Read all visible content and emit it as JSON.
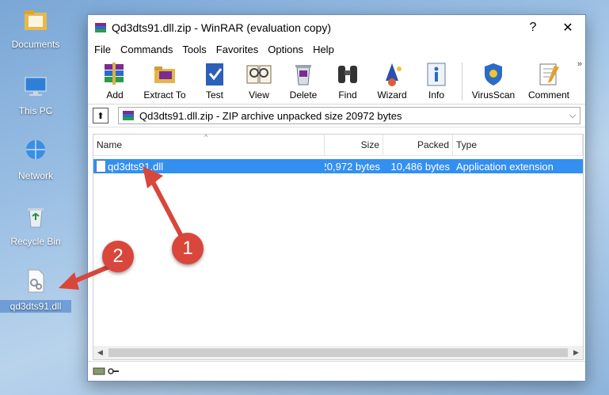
{
  "desktop": {
    "icons": [
      {
        "label": "Documents",
        "icon": "documents-folder-icon"
      },
      {
        "label": "This PC",
        "icon": "this-pc-icon"
      },
      {
        "label": "Network",
        "icon": "network-icon"
      },
      {
        "label": "Recycle Bin",
        "icon": "recycle-bin-icon"
      },
      {
        "label": "qd3dts91.dll",
        "icon": "dll-file-icon"
      }
    ]
  },
  "window": {
    "title": "Qd3dts91.dll.zip - WinRAR (evaluation copy)",
    "help_glyph": "?",
    "close_glyph": "✕",
    "menu": [
      "File",
      "Commands",
      "Tools",
      "Favorites",
      "Options",
      "Help"
    ],
    "toolbar": [
      "Add",
      "Extract To",
      "Test",
      "View",
      "Delete",
      "Find",
      "Wizard",
      "Info",
      "VirusScan",
      "Comment"
    ],
    "more_glyph": "»",
    "address": {
      "up_glyph": "⬆",
      "path": "Qd3dts91.dll.zip - ZIP archive unpacked size 20972 bytes",
      "dropdown_glyph": "⌵"
    },
    "columns": {
      "name": "Name",
      "size": "Size",
      "packed": "Packed",
      "type": "Type",
      "sort_glyph": "^"
    },
    "files": [
      {
        "name": "qd3dts91.dll",
        "size": "20,972 bytes",
        "packed": "10,486 bytes",
        "type": "Application extension"
      }
    ],
    "scroll": {
      "left": "◀",
      "right": "▶"
    }
  },
  "callouts": [
    {
      "number": "1"
    },
    {
      "number": "2"
    }
  ],
  "colors": {
    "selection": "#3390f0",
    "callout": "#d9463b"
  }
}
